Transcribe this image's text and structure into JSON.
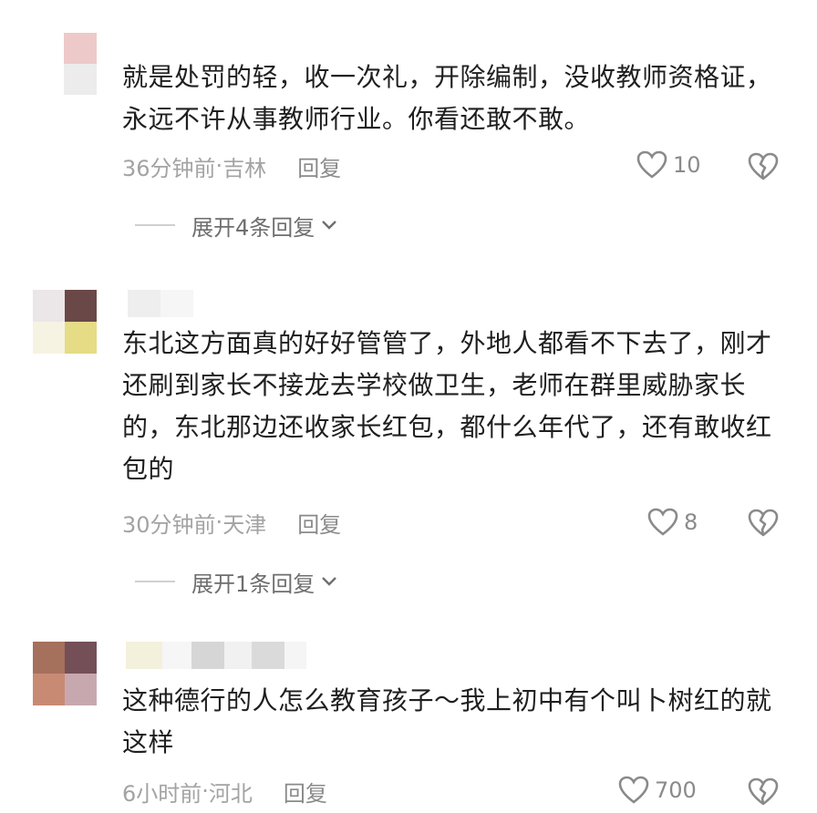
{
  "comments": [
    {
      "text": "就是处罚的轻，收一次礼，开除编制，没收教师资格证，永远不许从事教师行业。你看还敢不敢。",
      "time": "36分钟前",
      "location": "吉林",
      "reply_label": "回复",
      "likes": "10",
      "expand_label": "展开4条回复"
    },
    {
      "text": "东北这方面真的好好管管了，外地人都看不下去了，刚才还刷到家长不接龙去学校做卫生，老师在群里威胁家长的，东北那边还收家长红包，都什么年代了，还有敢收红包的",
      "time": "30分钟前",
      "location": "天津",
      "reply_label": "回复",
      "likes": "8",
      "expand_label": "展开1条回复"
    },
    {
      "text": "这种德行的人怎么教育孩子～我上初中有个叫卜树红的就这样",
      "time": "6小时前",
      "location": "河北",
      "reply_label": "回复",
      "likes": "700"
    }
  ],
  "separator": " · ",
  "icons": {
    "like": "heart-outline-icon",
    "dislike": "broken-heart-icon",
    "expand": "chevron-down-icon"
  },
  "colors": {
    "meta": "#a3a3a3",
    "icon": "#8a8a8a"
  }
}
